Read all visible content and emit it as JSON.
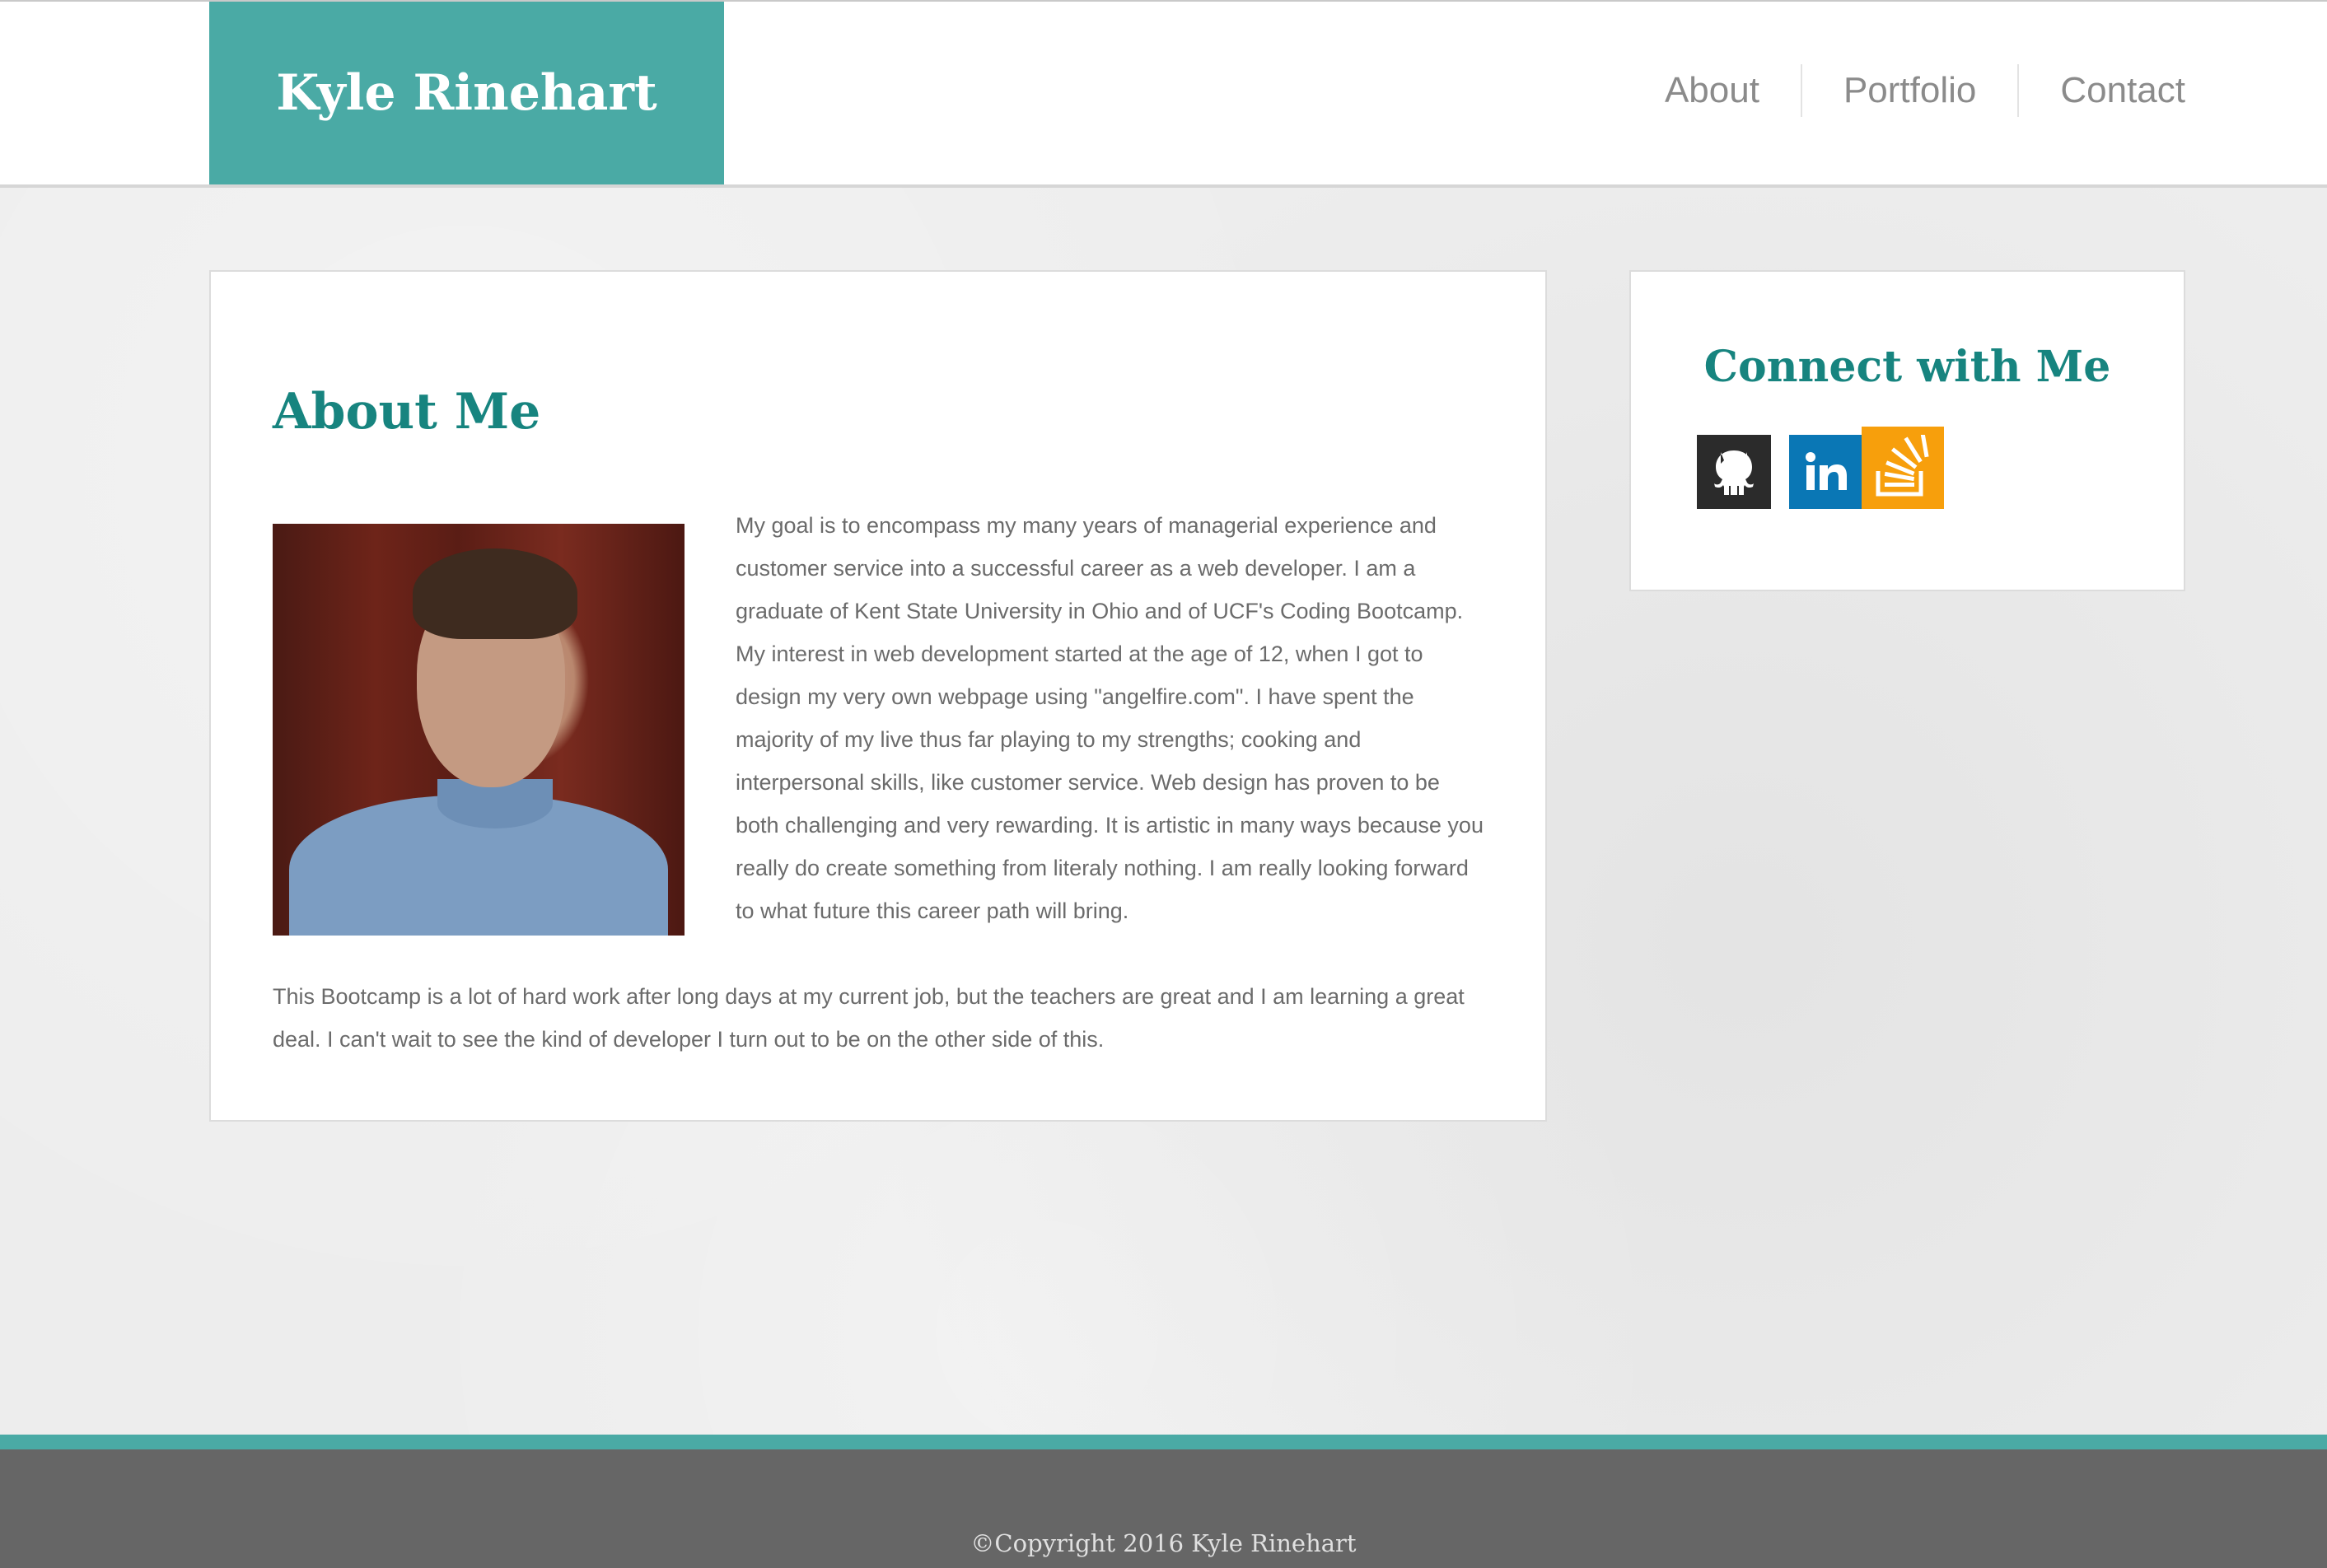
{
  "header": {
    "brand": "Kyle Rinehart",
    "nav": [
      {
        "label": "About"
      },
      {
        "label": "Portfolio"
      },
      {
        "label": "Contact"
      }
    ]
  },
  "about": {
    "title": "About Me",
    "photo_icon": "profile-photo",
    "paragraph_1": "My goal is to encompass my many years of managerial experience and customer service into a successful career as a web developer. I am a graduate of Kent State University in Ohio and of UCF's Coding Bootcamp. My interest in web development started at the age of 12, when I got to design my very own webpage using \"angelfire.com\". I have spent the majority of my live thus far playing to my strengths; cooking and interpersonal skills, like customer service. Web design has proven to be both challenging and very rewarding. It is artistic in many ways because you really do create something from literaly nothing. I am really looking forward to what future this career path will bring.",
    "paragraph_2": "This Bootcamp is a lot of hard work after long days at my current job, but the teachers are great and I am learning a great deal. I can't wait to see the kind of developer I turn out to be on the other side of this."
  },
  "connect": {
    "title": "Connect with Me",
    "social": [
      {
        "icon": "github-icon",
        "color": "#2b2b2b"
      },
      {
        "icon": "linkedin-icon",
        "color": "#0a77b5"
      },
      {
        "icon": "stackoverflow-icon",
        "color": "#f79f0c"
      }
    ]
  },
  "footer": {
    "copyright": "©Copyright 2016 Kyle Rinehart"
  },
  "colors": {
    "accent": "#4aaaa5",
    "heading": "#17847f",
    "footer": "#666666"
  }
}
